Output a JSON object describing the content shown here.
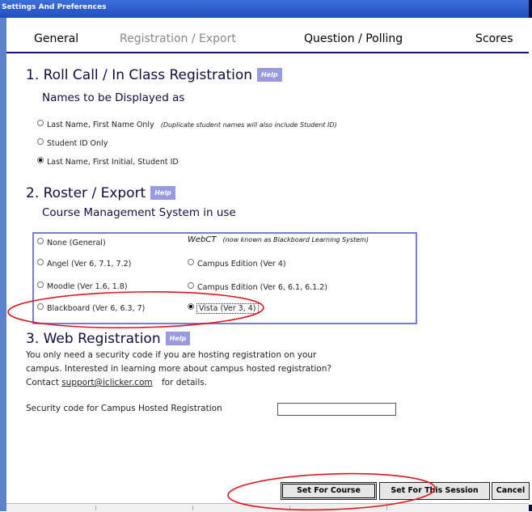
{
  "window": {
    "title": "Settings And Preferences"
  },
  "tabs": [
    "General",
    "Registration / Export",
    "Question / Polling",
    "Scores"
  ],
  "section1": {
    "heading": "1. Roll Call / In Class Registration",
    "help": "Help",
    "subheading": "Names to be Displayed as",
    "options": [
      {
        "label": "Last Name, First Name Only",
        "note": "(Duplicate student names will also include Student ID)",
        "selected": false
      },
      {
        "label": "Student ID Only",
        "note": "",
        "selected": false
      },
      {
        "label": "Last Name, First Initial, Student ID",
        "note": "",
        "selected": true
      }
    ]
  },
  "section2": {
    "heading": "2. Roster / Export",
    "help": "Help",
    "subheading": "Course Management System in use",
    "webct_title": "WebCT",
    "webct_note": "(now known as Blackboard Learning System)",
    "options": [
      {
        "label": "None (General)",
        "selected": false
      },
      {
        "label": "Angel (Ver 6, 7.1, 7.2)",
        "selected": false
      },
      {
        "label": "Moodle (Ver 1.6, 1.8)",
        "selected": false
      },
      {
        "label": "Blackboard (Ver 6, 6.3, 7)",
        "selected": false
      },
      {
        "label": "Campus Edition (Ver 4)",
        "selected": false
      },
      {
        "label": "Campus Edition (Ver 6, 6.1, 6.1.2)",
        "selected": false
      },
      {
        "label": "Vista (Ver 3, 4)",
        "selected": true
      }
    ]
  },
  "section3": {
    "heading": "3. Web Registration",
    "help": "Help",
    "line1": "You only need a security code if you are hosting registration on your",
    "line2": "campus. Interested in learning more about campus hosted registration?",
    "contact_prefix": "Contact",
    "email": "support@iclicker.com",
    "contact_suffix": "for details.",
    "security_label": "Security code for Campus Hosted Registration",
    "security_value": ""
  },
  "buttons": {
    "set_course": "Set For Course",
    "set_session": "Set For This Session",
    "cancel": "Cancel"
  },
  "colors": {
    "titlebar": "#2a5bcc",
    "accent": "#14147a",
    "annotation": "#e0141e"
  }
}
